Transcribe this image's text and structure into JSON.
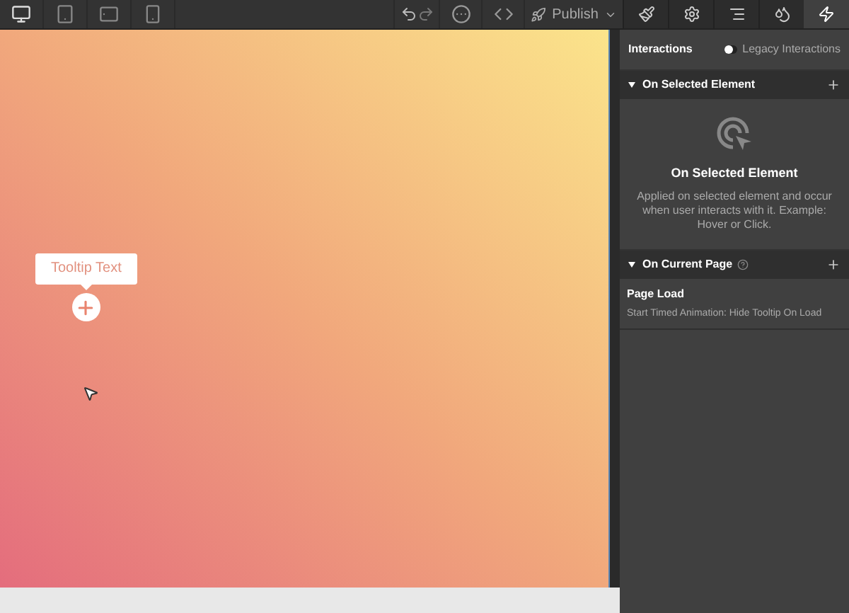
{
  "devices": [
    {
      "kind": "desktop",
      "selected": true
    },
    {
      "kind": "tablet",
      "selected": false
    },
    {
      "kind": "landscape",
      "selected": false
    },
    {
      "kind": "phone",
      "selected": false
    }
  ],
  "publish": {
    "label": "Publish"
  },
  "panel_tabs": [
    {
      "kind": "brush",
      "selected": false
    },
    {
      "kind": "gear",
      "selected": false
    },
    {
      "kind": "navigator",
      "selected": false
    },
    {
      "kind": "drops",
      "selected": false
    },
    {
      "kind": "bolt",
      "selected": true
    }
  ],
  "canvas": {
    "tooltip": "Tooltip Text"
  },
  "interactions": {
    "title": "Interactions",
    "legacy": {
      "label": "Legacy Interactions",
      "on": false
    },
    "selected_section": {
      "title": "On Selected Element",
      "expanded": true,
      "empty_title": "On Selected Element",
      "empty_text": "Applied on selected element and occur when user interacts with it. Example: Hover or Click."
    },
    "page_section": {
      "title": "On Current Page",
      "expanded": true,
      "items": [
        {
          "title": "Page Load",
          "detail": "Start Timed Animation: Hide Tooltip On Load"
        }
      ]
    }
  }
}
